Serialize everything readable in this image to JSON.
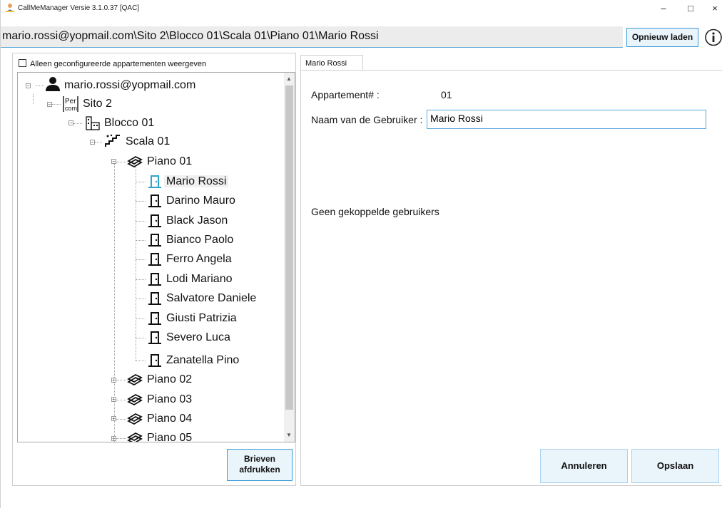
{
  "window": {
    "title": "CallMeManager Versie 3.1.0.37 [QAC]",
    "minimize_glyph": "–",
    "maximize_glyph": "□",
    "close_glyph": "×"
  },
  "pathbar": {
    "path": "mario.rossi@yopmail.com\\Sito 2\\Blocco 01\\Scala 01\\Piano 01\\Mario Rossi",
    "reload_label": "Opnieuw laden",
    "info_icon": "info-icon"
  },
  "left_panel": {
    "filter_checkbox_label": "Alleen geconfigureerde appartementen weergeven",
    "filter_checked": false,
    "print_label_line1": "Brieven",
    "print_label_line2": "afdrukken"
  },
  "tree": {
    "account": {
      "label": "mario.rossi@yopmail.com",
      "icon": "user-icon"
    },
    "site": {
      "label": "Sito 2",
      "icon": "site-icon"
    },
    "building": {
      "label": "Blocco 01",
      "icon": "building-icon"
    },
    "stair": {
      "label": "Scala 01",
      "icon": "stairs-icon"
    },
    "floors": [
      {
        "label": "Piano 01",
        "icon": "floor-icon",
        "expanded": true
      },
      {
        "label": "Piano 02",
        "icon": "floor-icon",
        "expanded": false
      },
      {
        "label": "Piano 03",
        "icon": "floor-icon",
        "expanded": false
      },
      {
        "label": "Piano 04",
        "icon": "floor-icon",
        "expanded": false
      },
      {
        "label": "Piano 05",
        "icon": "floor-icon",
        "expanded": false
      }
    ],
    "apartments": [
      {
        "label": "Mario Rossi",
        "selected": true
      },
      {
        "label": "Darino Mauro"
      },
      {
        "label": "Black Jason"
      },
      {
        "label": "Bianco Paolo"
      },
      {
        "label": "Ferro Angela"
      },
      {
        "label": "Lodi Mariano"
      },
      {
        "label": "Salvatore Daniele"
      },
      {
        "label": "Giusti Patrizia"
      },
      {
        "label": "Severo Luca"
      },
      {
        "label": "Zanatella Pino"
      }
    ]
  },
  "detail": {
    "tab_label": "Mario Rossi",
    "apartment_label": "Appartement# :",
    "apartment_value": "01",
    "username_label": "Naam van de Gebruiker :",
    "username_value": "Mario Rossi",
    "linked_users_text": "Geen gekoppelde gebruikers",
    "cancel_label": "Annuleren",
    "save_label": "Opslaan"
  },
  "colors": {
    "accent": "#3c9ad6",
    "selected_door": "#2fa5c8",
    "button_bg": "#eaf4fb"
  }
}
